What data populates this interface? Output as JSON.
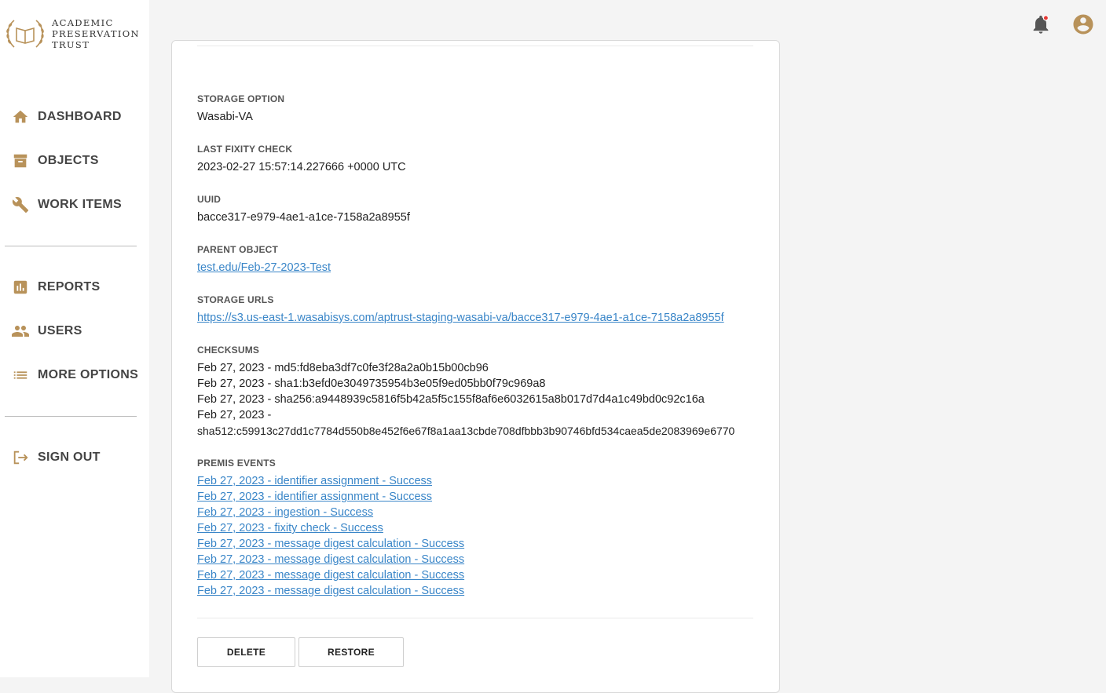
{
  "brand": {
    "line1": "ACADEMIC",
    "line2": "PRESERVATION",
    "line3": "TRUST",
    "accent": "#b8925a"
  },
  "sidebar": {
    "items": [
      {
        "label": "DASHBOARD",
        "icon": "home-icon"
      },
      {
        "label": "OBJECTS",
        "icon": "archive-icon"
      },
      {
        "label": "WORK ITEMS",
        "icon": "wrench-icon"
      },
      {
        "label": "REPORTS",
        "icon": "chart-icon"
      },
      {
        "label": "USERS",
        "icon": "users-icon"
      },
      {
        "label": "MORE OPTIONS",
        "icon": "list-icon"
      },
      {
        "label": "SIGN OUT",
        "icon": "sign-out-icon"
      }
    ]
  },
  "topbar": {
    "notification_icon": "bell-icon",
    "account_icon": "account-icon",
    "badge_color": "#e53935"
  },
  "detail": {
    "storage_option": {
      "label": "STORAGE OPTION",
      "value": "Wasabi-VA"
    },
    "last_fixity_check": {
      "label": "LAST FIXITY CHECK",
      "value": "2023-02-27 15:57:14.227666 +0000 UTC"
    },
    "uuid": {
      "label": "UUID",
      "value": "bacce317-e979-4ae1-a1ce-7158a2a8955f"
    },
    "parent_object": {
      "label": "PARENT OBJECT",
      "value": "test.edu/Feb-27-2023-Test"
    },
    "storage_urls": {
      "label": "STORAGE URLS",
      "value": "https://s3.us-east-1.wasabisys.com/aptrust-staging-wasabi-va/bacce317-e979-4ae1-a1ce-7158a2a8955f"
    },
    "checksums": {
      "label": "CHECKSUMS",
      "lines": [
        "Feb 27, 2023 - md5:fd8eba3df7c0fe3f28a2a0b15b00cb96",
        "Feb 27, 2023 - sha1:b3efd0e3049735954b3e05f9ed05bb0f79c969a8",
        "Feb 27, 2023 - sha256:a9448939c5816f5b42a5f5c155f8af6e6032615a8b017d7d4a1c49bd0c92c16a",
        "Feb 27, 2023 -",
        "sha512:c59913c27dd1c7784d550b8e452f6e67f8a1aa13cbde708dfbbb3b90746bfd534caea5de2083969e6770"
      ]
    },
    "premis_events": {
      "label": "PREMIS EVENTS",
      "events": [
        "Feb 27, 2023 - identifier assignment - Success",
        "Feb 27, 2023 - identifier assignment - Success",
        "Feb 27, 2023 - ingestion - Success",
        "Feb 27, 2023 - fixity check - Success",
        "Feb 27, 2023 - message digest calculation - Success",
        "Feb 27, 2023 - message digest calculation - Success",
        "Feb 27, 2023 - message digest calculation - Success",
        "Feb 27, 2023 - message digest calculation - Success"
      ]
    },
    "buttons": {
      "delete": "DELETE",
      "restore": "RESTORE"
    }
  }
}
